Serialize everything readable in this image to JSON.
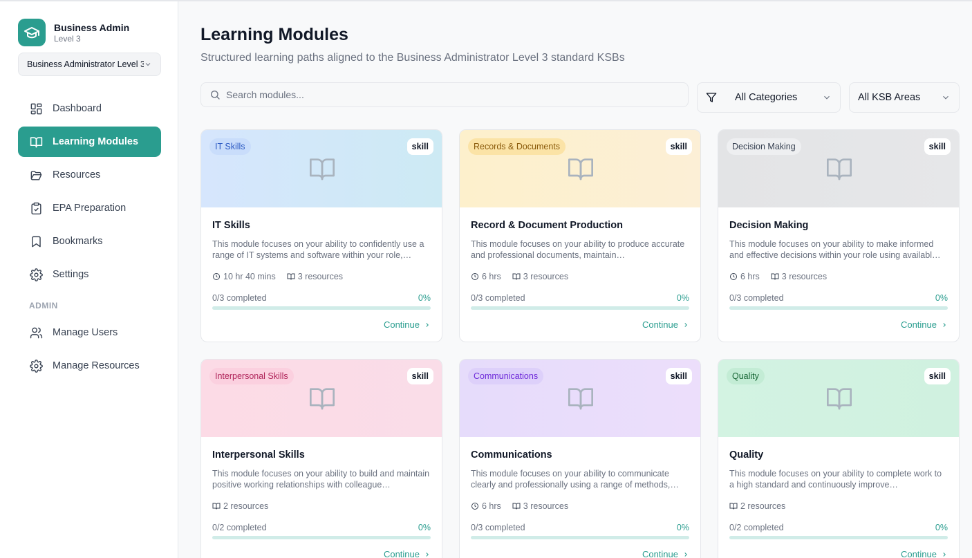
{
  "brand": {
    "title": "Business Admin",
    "subtitle": "Level 3"
  },
  "level_select": {
    "value": "Business Administrator Level 3"
  },
  "nav": [
    {
      "label": "Dashboard",
      "icon": "dashboard-icon",
      "active": false
    },
    {
      "label": "Learning Modules",
      "icon": "book-open-icon",
      "active": true
    },
    {
      "label": "Resources",
      "icon": "folder-open-icon",
      "active": false
    },
    {
      "label": "EPA Preparation",
      "icon": "clipboard-check-icon",
      "active": false
    },
    {
      "label": "Bookmarks",
      "icon": "bookmark-icon",
      "active": false
    },
    {
      "label": "Settings",
      "icon": "gear-icon",
      "active": false
    }
  ],
  "admin": {
    "section_label": "ADMIN",
    "items": [
      {
        "label": "Manage Users",
        "icon": "users-icon"
      },
      {
        "label": "Manage Resources",
        "icon": "gear-icon"
      }
    ]
  },
  "page": {
    "title": "Learning Modules",
    "subtitle": "Structured learning paths aligned to the Business Administrator Level 3 standard KSBs"
  },
  "search": {
    "placeholder": "Search modules..."
  },
  "filters": {
    "category": "All Categories",
    "ksb": "All KSB Areas"
  },
  "colors": {
    "accent": "#2a9d8f"
  },
  "modules": [
    {
      "category": "IT Skills",
      "type": "skill",
      "title": "IT Skills",
      "description": "This module focuses on your ability to confidently use a range of IT systems and software within your role,…",
      "duration": "10 hr 40 mins",
      "resources": "3 resources",
      "completed": "0/3 completed",
      "percent": "0%",
      "progress": 0,
      "continue": "Continue",
      "banner": "linear-gradient(90deg,#d6e6fd,#cdeaf4)",
      "pill_bg": "#c9ddfb",
      "pill_fg": "#2b59c3"
    },
    {
      "category": "Records & Documents",
      "type": "skill",
      "title": "Record & Document Production",
      "description": "This module focuses on your ability to produce accurate and professional documents, maintain…",
      "duration": "6 hrs",
      "resources": "3 resources",
      "completed": "0/3 completed",
      "percent": "0%",
      "progress": 0,
      "continue": "Continue",
      "banner": "linear-gradient(90deg,#fdf0cc,#fcefd6)",
      "pill_bg": "#fbe3a6",
      "pill_fg": "#8a5a0b"
    },
    {
      "category": "Decision Making",
      "type": "skill",
      "title": "Decision Making",
      "description": "This module focuses on your ability to make informed and effective decisions within your role using availabl…",
      "duration": "6 hrs",
      "resources": "3 resources",
      "completed": "0/3 completed",
      "percent": "0%",
      "progress": 0,
      "continue": "Continue",
      "banner": "linear-gradient(90deg,#e3e4e6,#e6e7e9)",
      "pill_bg": "#eeeff1",
      "pill_fg": "#374151"
    },
    {
      "category": "Interpersonal Skills",
      "type": "skill",
      "title": "Interpersonal Skills",
      "description": "This module focuses on your ability to build and maintain positive working relationships with colleague…",
      "duration": "",
      "resources": "2 resources",
      "completed": "0/2 completed",
      "percent": "0%",
      "progress": 0,
      "continue": "Continue",
      "banner": "linear-gradient(90deg,#fcdbe6,#fadde8)",
      "pill_bg": "#fbd0df",
      "pill_fg": "#b0245a"
    },
    {
      "category": "Communications",
      "type": "skill",
      "title": "Communications",
      "description": "This module focuses on your ability to communicate clearly and professionally using a range of methods,…",
      "duration": "6 hrs",
      "resources": "3 resources",
      "completed": "0/3 completed",
      "percent": "0%",
      "progress": 0,
      "continue": "Continue",
      "banner": "linear-gradient(90deg,#e6dcfb,#ecdefb)",
      "pill_bg": "#ddd0fa",
      "pill_fg": "#6d28d9"
    },
    {
      "category": "Quality",
      "type": "skill",
      "title": "Quality",
      "description": "This module focuses on your ability to complete work to a high standard and continuously improve…",
      "duration": "",
      "resources": "2 resources",
      "completed": "0/2 completed",
      "percent": "0%",
      "progress": 0,
      "continue": "Continue",
      "banner": "linear-gradient(90deg,#d3f3e2,#d0f1e0)",
      "pill_bg": "#c3ecd5",
      "pill_fg": "#166534"
    }
  ]
}
